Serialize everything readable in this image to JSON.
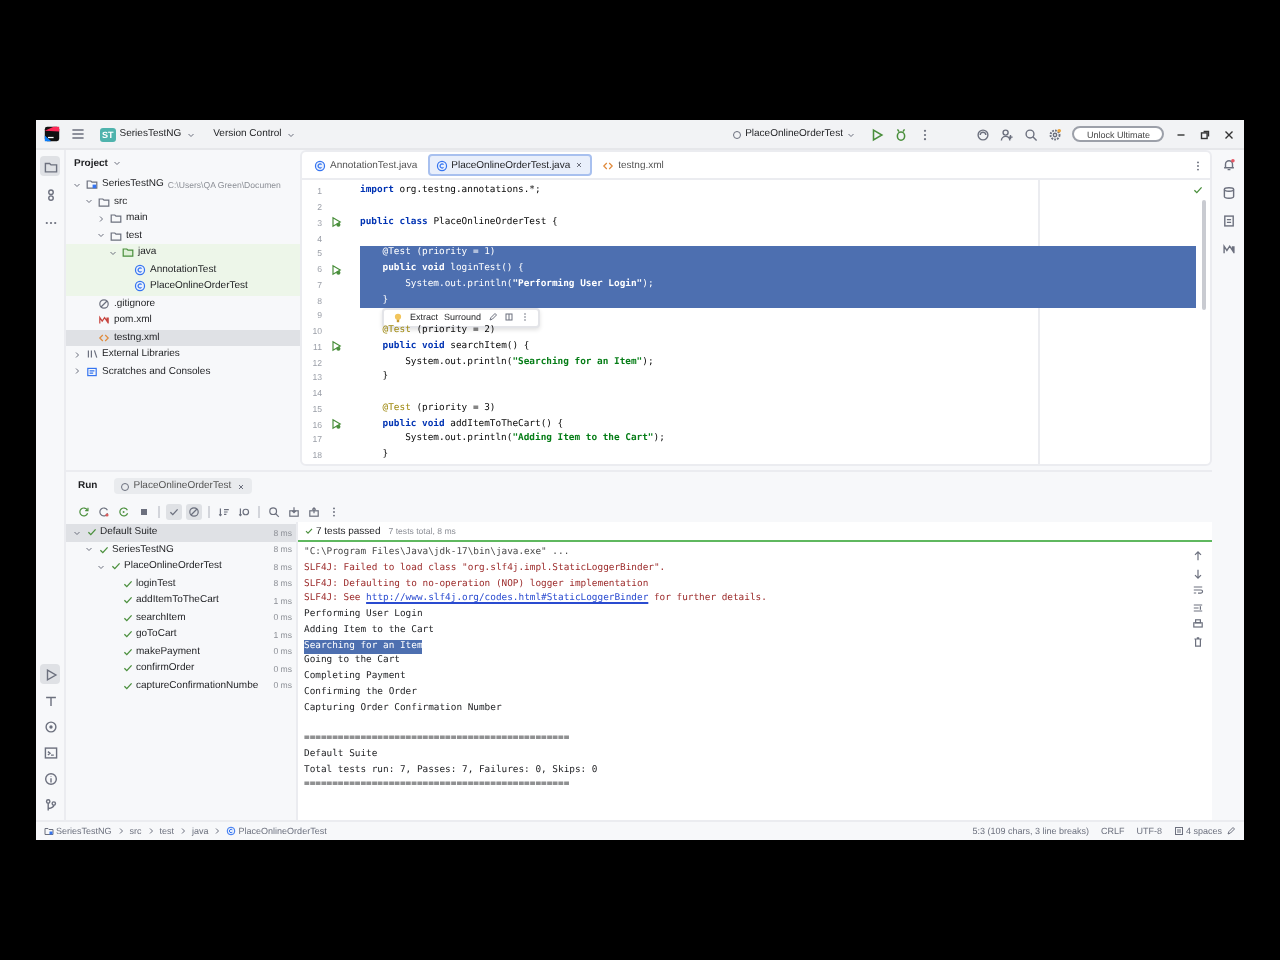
{
  "title_bar": {
    "project_badge": "ST",
    "project": "SeriesTestNG",
    "vcs": "Version Control",
    "run_config": "PlaceOnlineOrderTest",
    "unlock_button": "Unlock Ultimate"
  },
  "tool_strip": {
    "top": [
      {
        "kind": "project",
        "selected": true
      },
      {
        "kind": "commit",
        "selected": false
      },
      {
        "kind": "more",
        "selected": false
      }
    ],
    "bottom": [
      {
        "kind": "run",
        "selected": true
      },
      {
        "kind": "build",
        "selected": false
      },
      {
        "kind": "services",
        "selected": false
      },
      {
        "kind": "terminal",
        "selected": false
      },
      {
        "kind": "problems",
        "selected": false
      },
      {
        "kind": "git",
        "selected": false
      }
    ]
  },
  "project_panel": {
    "title": "Project",
    "tree": [
      {
        "label": "SeriesTestNG",
        "hint": "C:\\Users\\QA Green\\Documen",
        "kind": "module",
        "expanded": true,
        "selected": false,
        "highlighted": false,
        "children": [
          {
            "label": "src",
            "kind": "folder",
            "expanded": true,
            "selected": false,
            "highlighted": false,
            "children": [
              {
                "label": "main",
                "kind": "folder",
                "expanded": false,
                "selected": false,
                "highlighted": false
              },
              {
                "label": "test",
                "kind": "folder",
                "expanded": true,
                "selected": false,
                "highlighted": false,
                "children": [
                  {
                    "label": "java",
                    "kind": "test_folder",
                    "expanded": true,
                    "selected": false,
                    "highlighted": true,
                    "children": [
                      {
                        "label": "AnnotationTest",
                        "kind": "class",
                        "selected": false,
                        "highlighted": true
                      },
                      {
                        "label": "PlaceOnlineOrderTest",
                        "kind": "class",
                        "selected": false,
                        "highlighted": true
                      }
                    ]
                  }
                ]
              }
            ]
          },
          {
            "label": ".gitignore",
            "kind": "ignore",
            "selected": false,
            "highlighted": false
          },
          {
            "label": "pom.xml",
            "kind": "maven",
            "selected": false,
            "highlighted": false
          },
          {
            "label": "testng.xml",
            "kind": "xml",
            "selected": true,
            "highlighted": false
          }
        ]
      },
      {
        "label": "External Libraries",
        "kind": "library",
        "expanded": false,
        "selected": false,
        "highlighted": false
      },
      {
        "label": "Scratches and Consoles",
        "kind": "scratches",
        "expanded": false,
        "selected": false,
        "highlighted": false
      }
    ]
  },
  "editor": {
    "tabs": [
      {
        "label": "AnnotationTest.java",
        "kind": "class",
        "selected": false
      },
      {
        "label": "PlaceOnlineOrderTest.java",
        "kind": "class",
        "selected": true
      },
      {
        "label": "testng.xml",
        "kind": "xml",
        "selected": false
      }
    ],
    "lines": [
      {
        "number": "1",
        "run": false,
        "selected": false,
        "parts": [
          {
            "kind": "keyword",
            "text": "import"
          },
          {
            "kind": "plain",
            "text": " org.testng.annotations.*;"
          }
        ]
      },
      {
        "number": "2",
        "run": false,
        "selected": false
      },
      {
        "number": "3",
        "run": true,
        "selected": false,
        "parts": [
          {
            "kind": "keyword",
            "text": "public class"
          },
          {
            "kind": "plain",
            "text": " PlaceOnlineOrderTest {"
          }
        ]
      },
      {
        "number": "4",
        "run": false,
        "selected": false
      },
      {
        "number": "5",
        "run": false,
        "selected": true,
        "parts": [
          {
            "kind": "annotation",
            "text": "    @Test"
          },
          {
            "kind": "plain",
            "text": " (priority = 1)"
          }
        ]
      },
      {
        "number": "6",
        "run": true,
        "selected": true,
        "parts": [
          {
            "kind": "keyword",
            "text": "    public void"
          },
          {
            "kind": "plain",
            "text": " loginTest() {"
          }
        ]
      },
      {
        "number": "7",
        "run": false,
        "selected": true,
        "parts": [
          {
            "kind": "plain",
            "text": "        System.out.println("
          },
          {
            "kind": "string",
            "text": "\"Performing User Login\""
          },
          {
            "kind": "plain",
            "text": ");"
          }
        ]
      },
      {
        "number": "8",
        "run": false,
        "selected": true,
        "parts": [
          {
            "kind": "plain",
            "text": "    }"
          }
        ]
      },
      {
        "number": "9",
        "run": false,
        "selected": false
      },
      {
        "number": "10",
        "run": false,
        "selected": false,
        "parts": [
          {
            "kind": "annotation",
            "text": "    @Test"
          },
          {
            "kind": "plain",
            "text": " (priority = 2)"
          }
        ]
      },
      {
        "number": "11",
        "run": true,
        "selected": false,
        "parts": [
          {
            "kind": "keyword",
            "text": "    public void"
          },
          {
            "kind": "plain",
            "text": " searchItem() {"
          }
        ]
      },
      {
        "number": "12",
        "run": false,
        "selected": false,
        "parts": [
          {
            "kind": "plain",
            "text": "        System.out.println("
          },
          {
            "kind": "string",
            "text": "\"Searching for an Item\""
          },
          {
            "kind": "plain",
            "text": ");"
          }
        ]
      },
      {
        "number": "13",
        "run": false,
        "selected": false,
        "parts": [
          {
            "kind": "plain",
            "text": "    }"
          }
        ]
      },
      {
        "number": "14",
        "run": false,
        "selected": false
      },
      {
        "number": "15",
        "run": false,
        "selected": false,
        "parts": [
          {
            "kind": "annotation",
            "text": "    @Test"
          },
          {
            "kind": "plain",
            "text": " (priority = 3)"
          }
        ]
      },
      {
        "number": "16",
        "run": true,
        "selected": false,
        "parts": [
          {
            "kind": "keyword",
            "text": "    public void"
          },
          {
            "kind": "plain",
            "text": " addItemToTheCart() {"
          }
        ]
      },
      {
        "number": "17",
        "run": false,
        "selected": false,
        "parts": [
          {
            "kind": "plain",
            "text": "        System.out.println("
          },
          {
            "kind": "string",
            "text": "\"Adding Item to the Cart\""
          },
          {
            "kind": "plain",
            "text": ");"
          }
        ]
      },
      {
        "number": "18",
        "run": false,
        "selected": false,
        "parts": [
          {
            "kind": "plain",
            "text": "    }"
          }
        ]
      }
    ],
    "popup": {
      "items": [
        "Extract",
        "Surround"
      ]
    }
  },
  "run_panel": {
    "title": "Run",
    "tab": "PlaceOnlineOrderTest",
    "toolbar": [
      {
        "kind": "rerun",
        "pressed": false
      },
      {
        "kind": "rerun_failed",
        "pressed": false
      },
      {
        "kind": "toggle",
        "pressed": false
      },
      {
        "kind": "stop",
        "pressed": false
      },
      {
        "kind": "show_passed",
        "pressed": true
      },
      {
        "kind": "show_ignored",
        "pressed": true
      },
      {
        "kind": "sort",
        "pressed": false
      },
      {
        "kind": "sort_duration",
        "pressed": false
      },
      {
        "kind": "search",
        "pressed": false
      },
      {
        "kind": "import",
        "pressed": false
      },
      {
        "kind": "export",
        "pressed": false
      },
      {
        "kind": "more",
        "pressed": false
      }
    ],
    "tree": [
      {
        "label": "Default Suite",
        "time": "8 ms",
        "passed": true,
        "expanded": true,
        "selected": true,
        "children": [
          {
            "label": "SeriesTestNG",
            "time": "8 ms",
            "passed": true,
            "expanded": true,
            "selected": false,
            "children": [
              {
                "label": "PlaceOnlineOrderTest",
                "time": "8 ms",
                "passed": true,
                "expanded": true,
                "selected": false,
                "children": [
                  {
                    "label": "loginTest",
                    "time": "8 ms",
                    "passed": true,
                    "selected": false
                  },
                  {
                    "label": "addItemToTheCart",
                    "time": "1 ms",
                    "passed": true,
                    "selected": false
                  },
                  {
                    "label": "searchItem",
                    "time": "0 ms",
                    "passed": true,
                    "selected": false
                  },
                  {
                    "label": "goToCart",
                    "time": "1 ms",
                    "passed": true,
                    "selected": false
                  },
                  {
                    "label": "makePayment",
                    "time": "0 ms",
                    "passed": true,
                    "selected": false
                  },
                  {
                    "label": "confirmOrder",
                    "time": "0 ms",
                    "passed": true,
                    "selected": false
                  },
                  {
                    "label": "captureConfirmationNumbe",
                    "time": "0 ms",
                    "passed": true,
                    "selected": false
                  }
                ]
              }
            ]
          }
        ]
      }
    ],
    "result": "7 tests passed",
    "result_detail": "7 tests total, 8 ms",
    "output": [
      {
        "kind": "command",
        "text": "\"C:\\Program Files\\Java\\jdk-17\\bin\\java.exe\" ...",
        "selected": false
      },
      {
        "kind": "error",
        "text": "SLF4J: Failed to load class \"org.slf4j.impl.StaticLoggerBinder\".",
        "selected": false
      },
      {
        "kind": "error",
        "text": "SLF4J: Defaulting to no-operation (NOP) logger implementation",
        "selected": false
      },
      {
        "kind": "error",
        "text": "SLF4J: See ",
        "link": "http://www.slf4j.org/codes.html#StaticLoggerBinder",
        "after": " for further details.",
        "selected": false
      },
      {
        "kind": "normal",
        "text": "Performing User Login",
        "selected": false
      },
      {
        "kind": "normal",
        "text": "Adding Item to the Cart",
        "selected": false
      },
      {
        "kind": "normal",
        "text": "Searching for an Item",
        "selected": true
      },
      {
        "kind": "normal",
        "text": "Going to the Cart",
        "selected": false
      },
      {
        "kind": "normal",
        "text": "Completing Payment",
        "selected": false
      },
      {
        "kind": "normal",
        "text": "Confirming the Order",
        "selected": false
      },
      {
        "kind": "normal",
        "text": "Capturing Order Confirmation Number",
        "selected": false
      }
    ],
    "summary": [
      "===============================================",
      "Default Suite",
      "Total tests run: 7, Passes: 7, Failures: 0, Skips: 0",
      "==============================================="
    ]
  },
  "status_bar": {
    "breadcrumb": [
      {
        "label": "SeriesTestNG",
        "kind": "module"
      },
      {
        "label": "src",
        "kind": "plain"
      },
      {
        "label": "test",
        "kind": "plain"
      },
      {
        "label": "java",
        "kind": "plain"
      },
      {
        "label": "PlaceOnlineOrderTest",
        "kind": "class"
      }
    ],
    "position": "5:3 (109 chars, 3 line breaks)",
    "line_separator": "CRLF",
    "encoding": "UTF-8",
    "indent": "4 spaces"
  }
}
